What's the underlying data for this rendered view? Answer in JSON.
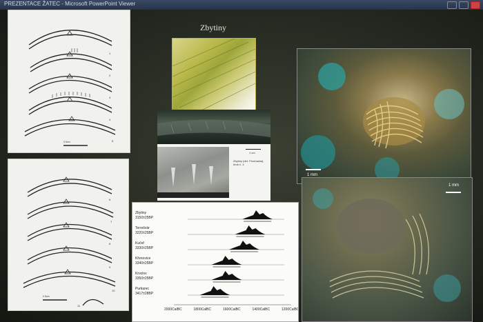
{
  "window": {
    "title": "PREZENTACE ŽATEC - Microsoft PowerPoint Viewer"
  },
  "slide": {
    "title": "Zbytiny",
    "inset_caption": "Zbytiny (det. Prochazka), hrob č. 4",
    "inset_scale": "1 cm",
    "photo_scale_top": "1 mm",
    "photo_scale_bottom": "1 mm"
  },
  "drawing_top": {
    "numbers": [
      "1",
      "2",
      "3",
      "4",
      "5"
    ],
    "scale": "0  5cm"
  },
  "drawing_bottom": {
    "numbers": [
      "6",
      "7",
      "8",
      "9",
      "10",
      "11"
    ],
    "scale": "0  5cm"
  },
  "chart_data": {
    "type": "area",
    "title": "",
    "xlabel": "",
    "ylabel": "",
    "x_ticks": [
      "2000CalBC",
      "1800CalBC",
      "1600CalBC",
      "1400CalBC",
      "1200CalBC"
    ],
    "xlim": [
      2000,
      1200
    ],
    "series": [
      {
        "name": "Zbytiny",
        "date": "3150±25BP",
        "peak_calbc": 1430
      },
      {
        "name": "Terrešvár",
        "date": "3220±25BP",
        "peak_calbc": 1480
      },
      {
        "name": "Kučeř",
        "date": "3330±25BP",
        "peak_calbc": 1520
      },
      {
        "name": "Křenovice",
        "date": "3340±25BP",
        "peak_calbc": 1640
      },
      {
        "name": "Kroclov",
        "date": "3350±25BP",
        "peak_calbc": 1640
      },
      {
        "name": "Purkarec",
        "date": "3417±28BP",
        "peak_calbc": 1720
      }
    ]
  }
}
